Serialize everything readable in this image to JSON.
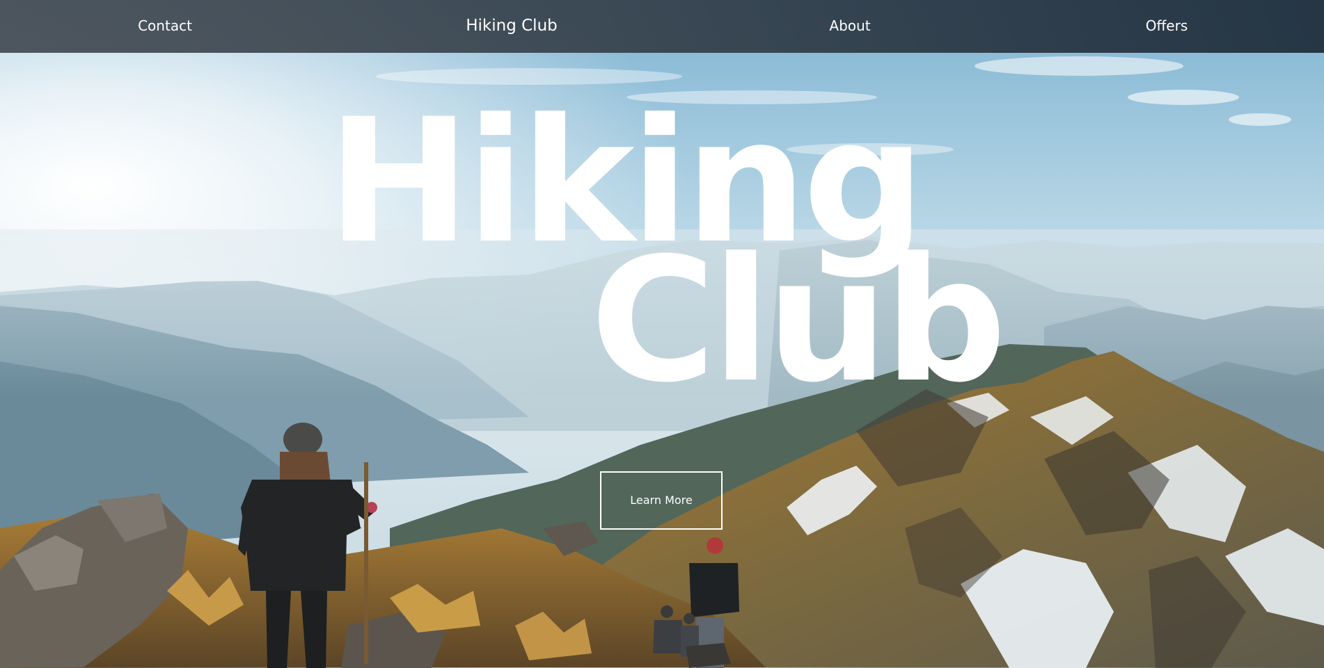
{
  "nav": {
    "contact_label": "Contact",
    "brand_label": "Hiking Club",
    "about_label": "About",
    "offers_label": "Offers"
  },
  "hero": {
    "headline_line1": "Hiking",
    "headline_line2": "Club",
    "cta_label": "Learn More"
  },
  "colors": {
    "nav_background": "#37444f",
    "text": "#ffffff",
    "sky": "#8fc3dc",
    "grass": "#b8893a",
    "snow": "#eef2f5"
  }
}
